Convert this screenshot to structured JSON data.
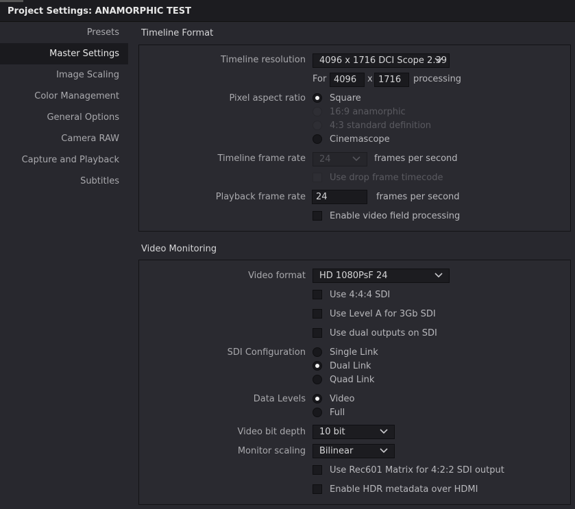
{
  "window": {
    "title": "Project Settings:  ANAMORPHIC TEST"
  },
  "sidebar": {
    "items": [
      {
        "label": "Presets"
      },
      {
        "label": "Master Settings"
      },
      {
        "label": "Image Scaling"
      },
      {
        "label": "Color Management"
      },
      {
        "label": "General Options"
      },
      {
        "label": "Camera RAW"
      },
      {
        "label": "Capture and Playback"
      },
      {
        "label": "Subtitles"
      }
    ],
    "active": "Master Settings"
  },
  "timeline_format": {
    "title": "Timeline Format",
    "resolution_label": "Timeline resolution",
    "resolution_value": "4096 x 1716 DCI Scope 2.39",
    "for_label": "For",
    "width": "4096",
    "x_label": "x",
    "height": "1716",
    "processing_label": "processing",
    "pixel_aspect_label": "Pixel aspect ratio",
    "pixel_aspect_options": [
      {
        "label": "Square",
        "selected": true,
        "enabled": true
      },
      {
        "label": "16:9 anamorphic",
        "selected": false,
        "enabled": false
      },
      {
        "label": "4:3 standard definition",
        "selected": false,
        "enabled": false
      },
      {
        "label": "Cinemascope",
        "selected": false,
        "enabled": true
      }
    ],
    "frame_rate_label": "Timeline frame rate",
    "frame_rate_value": "24",
    "frames_per_second": "frames per second",
    "drop_frame_label": "Use drop frame timecode",
    "playback_rate_label": "Playback frame rate",
    "playback_rate_value": "24",
    "playback_fps": "frames per second",
    "video_field_label": "Enable video field processing"
  },
  "video_monitoring": {
    "title": "Video Monitoring",
    "format_label": "Video format",
    "format_value": "HD 1080PsF 24",
    "use_444": "Use 4:4:4 SDI",
    "level_a": "Use Level A for 3Gb SDI",
    "dual_outputs": "Use dual outputs on SDI",
    "sdi_config_label": "SDI Configuration",
    "sdi_options": [
      {
        "label": "Single Link",
        "selected": false
      },
      {
        "label": "Dual Link",
        "selected": true
      },
      {
        "label": "Quad Link",
        "selected": false
      }
    ],
    "data_levels_label": "Data Levels",
    "data_levels_options": [
      {
        "label": "Video",
        "selected": true
      },
      {
        "label": "Full",
        "selected": false
      }
    ],
    "bit_depth_label": "Video bit depth",
    "bit_depth_value": "10 bit",
    "scaling_label": "Monitor scaling",
    "scaling_value": "Bilinear",
    "rec601": "Use Rec601 Matrix for 4:2:2 SDI output",
    "hdr_metadata": "Enable HDR metadata over HDMI"
  },
  "colors": {
    "background": "#28282e",
    "panel": "#2a2a30",
    "sidebar_active": "#1a1a1e",
    "text": "#b8b8bc"
  }
}
